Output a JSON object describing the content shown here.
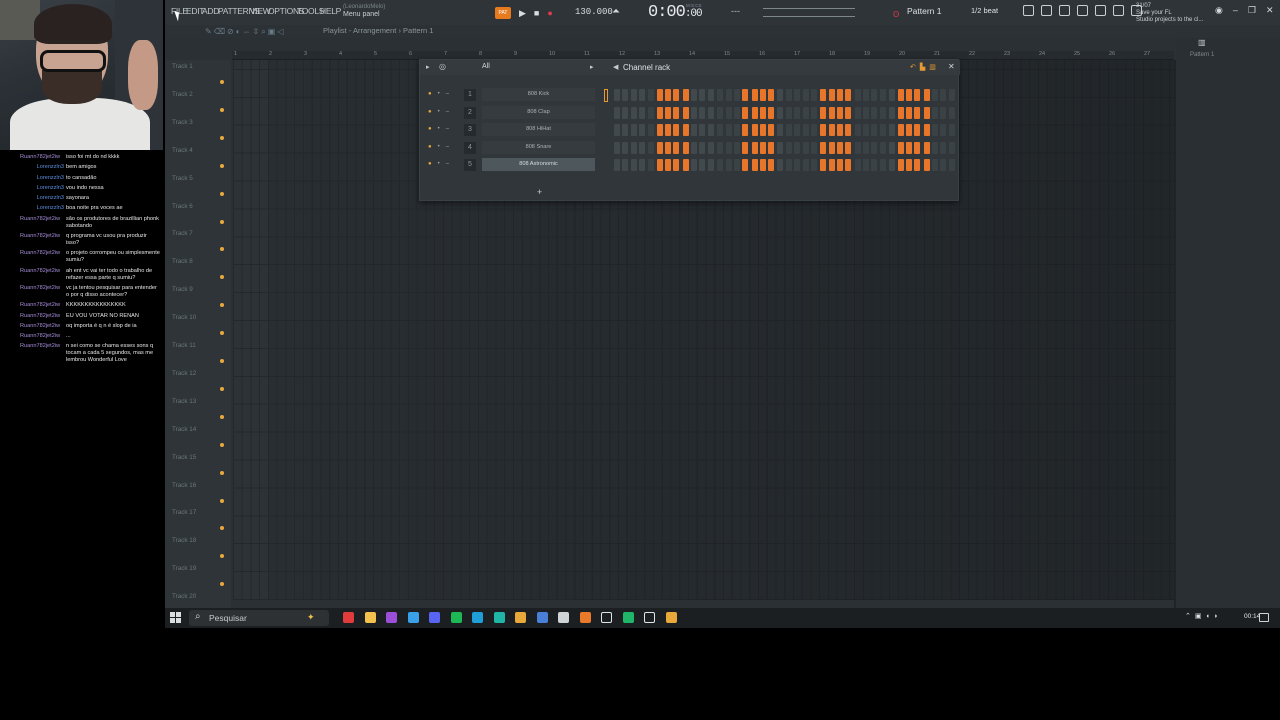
{
  "chat": {
    "messages": [
      {
        "user": "Ruann782jet2iw",
        "text": "isso foi mt do nd kkkk",
        "color": "purple"
      },
      {
        "user": "Lorenzzln3",
        "text": "bem amigos",
        "color": "blue"
      },
      {
        "user": "Lorenzzln3",
        "text": "to cansadão",
        "color": "blue"
      },
      {
        "user": "Lorenzzln3",
        "text": "vou indo nessa",
        "color": "blue"
      },
      {
        "user": "Lorenzzln3",
        "text": "sayonara",
        "color": "blue"
      },
      {
        "user": "Lorenzzln3",
        "text": "boa noite pra voces ae",
        "color": "blue"
      },
      {
        "user": "Ruann782jet2iw",
        "text": "são os produtores de brazillian phonk sabotando",
        "color": "purple"
      },
      {
        "user": "Ruann782jet2iw",
        "text": "q programa vc usou pra produzir isso?",
        "color": "purple"
      },
      {
        "user": "Ruann782jet2iw",
        "text": "o projeto corrompeu ou simplesmente sumiu?",
        "color": "purple"
      },
      {
        "user": "Ruann782jet2iw",
        "text": "ah ent vc vai ter todo o trabalho de refazer essa parte q sumiu?",
        "color": "purple"
      },
      {
        "user": "Ruann782jet2iw",
        "text": "vc ja tentou pesquisar para entender o por q disso acontecer?",
        "color": "purple"
      },
      {
        "user": "Ruann782jet2iw",
        "text": "KKKKKKKKKKKKKKKK",
        "color": "purple"
      },
      {
        "user": "Ruann782jet2iw",
        "text": "EU VOU VOTAR NO RENAN",
        "color": "purple"
      },
      {
        "user": "Ruann782jet2iw",
        "text": "oq importa é q n é slop de ia",
        "color": "purple"
      },
      {
        "user": "Ruann782jet2iw",
        "text": "...",
        "color": "purple"
      },
      {
        "user": "Ruann782jet2iw",
        "text": "n sei como se chama esses sons q tocam a cada 5 segundos, mas me lembrou Wonderful Love",
        "color": "purple"
      }
    ]
  },
  "menu": {
    "items": [
      "FILE",
      "EDIT",
      "ADD",
      "PATTERNS",
      "VIEW",
      "OPTIONS",
      "TOOLS",
      "HELP"
    ],
    "hint_user": "(LeonardoMelo)",
    "hint_text": "Menu panel"
  },
  "transport": {
    "pattern_badge": "PAT",
    "play": "▶",
    "stop": "■",
    "record": "●",
    "tempo": "130.000",
    "time": "0:00",
    "time_small": ":00",
    "time_unit": "M:S:CS",
    "dash": "---"
  },
  "toolbar": {
    "pattern": "Pattern 1",
    "snap": "1/2 beat",
    "news_date": "31/07",
    "news_line1": "Save your FL",
    "news_line2": "Studio projects to the cl..."
  },
  "playlist": {
    "title": "Playlist - Arrangement › Pattern 1",
    "ruler": [
      "1",
      "2",
      "3",
      "4",
      "5",
      "6",
      "7",
      "8",
      "9",
      "10",
      "11",
      "12",
      "13",
      "14",
      "15",
      "16",
      "17",
      "18",
      "19",
      "20",
      "21",
      "22",
      "23",
      "24",
      "25",
      "26",
      "27"
    ],
    "tracks": [
      "Track 1",
      "Track 2",
      "Track 3",
      "Track 4",
      "Track 5",
      "Track 6",
      "Track 7",
      "Track 8",
      "Track 9",
      "Track 10",
      "Track 11",
      "Track 12",
      "Track 13",
      "Track 14",
      "Track 15",
      "Track 16",
      "Track 17",
      "Track 18",
      "Track 19",
      "Track 20"
    ],
    "picker_item": "Pattern 1"
  },
  "channel_rack": {
    "filter": "All",
    "title": "Channel rack",
    "add": "+",
    "channels": [
      {
        "num": "1",
        "name": "808 Kick",
        "steps": [
          0,
          0,
          0,
          0,
          0,
          1,
          1,
          1,
          1,
          0,
          0,
          0,
          0,
          0,
          0,
          1,
          1,
          1,
          1,
          0,
          0,
          0,
          0,
          0,
          1,
          1,
          1,
          1,
          0,
          0,
          0,
          0,
          0,
          1,
          1,
          1,
          1,
          0,
          0,
          0
        ]
      },
      {
        "num": "2",
        "name": "808 Clap",
        "steps": [
          0,
          0,
          0,
          0,
          0,
          1,
          1,
          1,
          1,
          0,
          0,
          0,
          0,
          0,
          0,
          1,
          1,
          1,
          1,
          0,
          0,
          0,
          0,
          0,
          1,
          1,
          1,
          1,
          0,
          0,
          0,
          0,
          0,
          1,
          1,
          1,
          1,
          0,
          0,
          0
        ]
      },
      {
        "num": "3",
        "name": "808 HiHat",
        "steps": [
          0,
          0,
          0,
          0,
          0,
          1,
          1,
          1,
          1,
          0,
          0,
          0,
          0,
          0,
          0,
          1,
          1,
          1,
          1,
          0,
          0,
          0,
          0,
          0,
          1,
          1,
          1,
          1,
          0,
          0,
          0,
          0,
          0,
          1,
          1,
          1,
          1,
          0,
          0,
          0
        ]
      },
      {
        "num": "4",
        "name": "808 Snare",
        "steps": [
          0,
          0,
          0,
          0,
          0,
          1,
          1,
          1,
          1,
          0,
          0,
          0,
          0,
          0,
          0,
          1,
          1,
          1,
          1,
          0,
          0,
          0,
          0,
          0,
          1,
          1,
          1,
          1,
          0,
          0,
          0,
          0,
          0,
          1,
          1,
          1,
          1,
          0,
          0,
          0
        ]
      },
      {
        "num": "5",
        "name": "808 Astronomic",
        "steps": [
          0,
          0,
          0,
          0,
          0,
          1,
          1,
          1,
          1,
          0,
          0,
          0,
          0,
          0,
          0,
          1,
          1,
          1,
          1,
          0,
          0,
          0,
          0,
          0,
          1,
          1,
          1,
          1,
          0,
          0,
          0,
          0,
          0,
          1,
          1,
          1,
          1,
          0,
          0,
          0
        ]
      }
    ]
  },
  "taskbar": {
    "search_placeholder": "Pesquisar",
    "clock": "00:14",
    "app_colors": [
      "#e23b3b",
      "#f2c14e",
      "#9b4fd8",
      "#3aa0e8",
      "#5865f2",
      "#1db954",
      "#1f9ed8",
      "#1fb6a6",
      "#e8a93a",
      "#4a7fd8",
      "#cfd4d7",
      "#e87a2a",
      "#ffffff",
      "#1fb66a",
      "#ffffff",
      "#e8a93a"
    ]
  },
  "colors": {
    "accent": "#e8762a",
    "step_on": "#e8762a",
    "chat_user_purple": "#a68cd8",
    "chat_user_blue": "#5a8fe0"
  }
}
